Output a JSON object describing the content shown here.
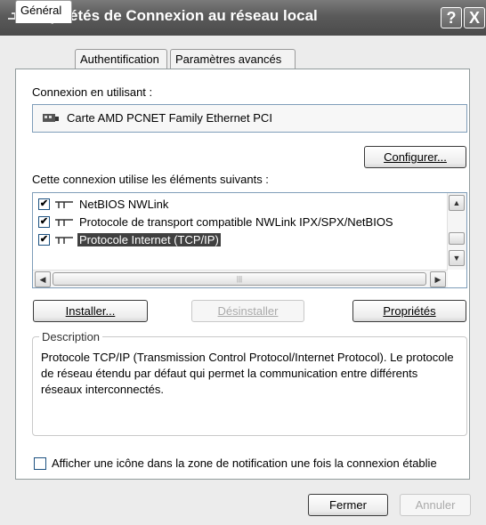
{
  "window": {
    "title": "Propriétés de Connexion au réseau local",
    "help_glyph": "?",
    "close_glyph": "X"
  },
  "tabs": [
    {
      "label": "Général",
      "active": true
    },
    {
      "label": "Authentification",
      "active": false
    },
    {
      "label": "Paramètres avancés",
      "active": false
    }
  ],
  "connection": {
    "label": "Connexion en utilisant :",
    "adapter": "Carte AMD PCNET Family Ethernet PCI",
    "configure_button": "Configurer..."
  },
  "components": {
    "label": "Cette connexion utilise les éléments suivants :",
    "items": [
      {
        "label": "NetBIOS NWLink",
        "checked": true,
        "selected": false
      },
      {
        "label": "Protocole de transport compatible NWLink IPX/SPX/NetBIOS",
        "checked": true,
        "selected": false
      },
      {
        "label": "Protocole Internet (TCP/IP)",
        "checked": true,
        "selected": true
      }
    ]
  },
  "actions": {
    "install": "Installer...",
    "uninstall": "Désinstaller",
    "properties": "Propriétés"
  },
  "description": {
    "legend": "Description",
    "text": "Protocole TCP/IP (Transmission Control Protocol/Internet Protocol). Le protocole de réseau étendu par défaut qui permet la communication entre différents réseaux interconnectés."
  },
  "notification_checkbox": {
    "label": "Afficher une icône dans la zone de notification une fois la connexion établie",
    "checked": false
  },
  "footer": {
    "close": "Fermer",
    "cancel": "Annuler"
  }
}
